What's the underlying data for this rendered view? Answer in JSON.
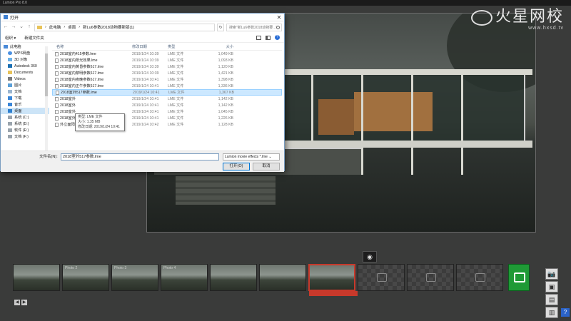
{
  "app": {
    "title": "Lumion Pro 8.0"
  },
  "logo": {
    "main": "火星网校",
    "sub": "www.hxsd.tv"
  },
  "dialog": {
    "title": "打开",
    "close": "✕",
    "address": {
      "crumbs": [
        "此电脑",
        "桌面",
        "新Lu6参数2018动物要新版(1)"
      ],
      "search_placeholder": "搜索\"新Lu6参数2018动物要...\""
    },
    "toolbar": {
      "organize": "组织 ▾",
      "new_folder": "新建文件夹"
    },
    "nav": [
      {
        "label": "此电脑",
        "icon": "computer-icon"
      },
      {
        "label": "WPS网盘",
        "icon": "cloud-icon"
      },
      {
        "label": "3D 对象",
        "icon": "cube-icon"
      },
      {
        "label": "Autodesk 360",
        "icon": "autodesk-icon"
      },
      {
        "label": "Documents",
        "icon": "folder-icon"
      },
      {
        "label": "Videos",
        "icon": "video-icon"
      },
      {
        "label": "图片",
        "icon": "picture-icon"
      },
      {
        "label": "文档",
        "icon": "document-icon"
      },
      {
        "label": "下载",
        "icon": "download-icon"
      },
      {
        "label": "音乐",
        "icon": "music-icon"
      },
      {
        "label": "桌面",
        "icon": "desktop-icon"
      },
      {
        "label": "系统 (C:)",
        "icon": "drive-icon"
      },
      {
        "label": "系统 (D:)",
        "icon": "drive-icon"
      },
      {
        "label": "软件 (E:)",
        "icon": "drive-icon"
      },
      {
        "label": "文档 (F:)",
        "icon": "drive-icon"
      }
    ],
    "columns": {
      "name": "名称",
      "date": "修改日期",
      "type": "类型",
      "size": "大小"
    },
    "files": [
      {
        "name": "2018室内415参数.lme",
        "date": "2019/1/24 10:39",
        "type": "LME 文件",
        "size": "1,049 KB"
      },
      {
        "name": "2018室内阳光效果.lme",
        "date": "2019/1/24 10:39",
        "type": "LME 文件",
        "size": "1,093 KB"
      },
      {
        "name": "2018室内黄昏参数617.lme",
        "date": "2019/1/24 10:39",
        "type": "LME 文件",
        "size": "1,120 KB"
      },
      {
        "name": "2018室内黎明参数617.lme",
        "date": "2019/1/24 10:39",
        "type": "LME 文件",
        "size": "1,421 KB"
      },
      {
        "name": "2018室内夜晚参数617.lme",
        "date": "2019/1/24 10:41",
        "type": "LME 文件",
        "size": "1,398 KB"
      },
      {
        "name": "2018室内正午参数617.lme",
        "date": "2019/1/24 10:41",
        "type": "LME 文件",
        "size": "1,336 KB"
      },
      {
        "name": "2018室外517参数.lme",
        "date": "2019/1/24 10:41",
        "type": "LME 文件",
        "size": "1,367 KB"
      },
      {
        "name": "2018室外",
        "date": "2019/1/24 10:41",
        "type": "LME 文件",
        "size": "1,142 KB"
      },
      {
        "name": "2018室外",
        "date": "2019/1/24 10:41",
        "type": "LME 文件",
        "size": "1,142 KB"
      },
      {
        "name": "2018室外",
        "date": "2019/1/24 10:41",
        "type": "LME 文件",
        "size": "1,045 KB"
      },
      {
        "name": "2018室外夜晚效果.lme",
        "date": "2019/1/24 10:41",
        "type": "LME 文件",
        "size": "1,226 KB"
      },
      {
        "name": "外立面阳光参考.lme",
        "date": "2019/1/24 10:42",
        "type": "LME 文件",
        "size": "1,128 KB"
      }
    ],
    "tooltip": {
      "type": "类型: LME 文件",
      "size": "大小: 1.35 MB",
      "date": "修改日期: 2019/1/24 10:41"
    },
    "filename_label": "文件名(N):",
    "filename_value": "2018室外517参数.lme",
    "filetype_value": "Lumion movie effects *.lme",
    "open_label": "打开(O)",
    "cancel_label": "取消"
  },
  "filmstrip": {
    "thumbs": [
      "",
      "Photo 2",
      "Photo 3",
      "Photo 4",
      "",
      "",
      "",
      "",
      "",
      ""
    ],
    "add_scene_icon": "photo-add-icon"
  },
  "side_tools": [
    "📷",
    "▣",
    "▤",
    "▥"
  ],
  "help": "?"
}
